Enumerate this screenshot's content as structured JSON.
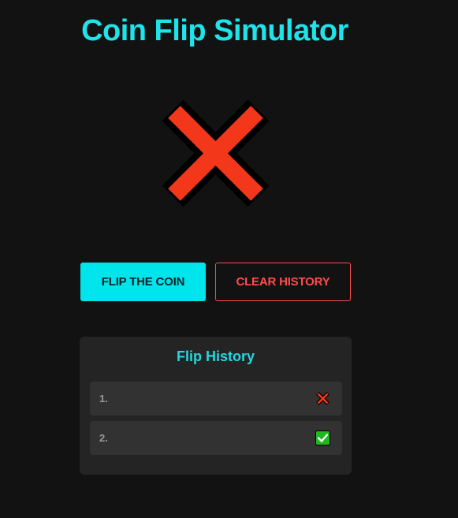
{
  "app": {
    "title": "Coin Flip Simulator"
  },
  "result": {
    "icon": "cross-mark-icon",
    "color": "#f2371b"
  },
  "buttons": {
    "flip_label": "FLIP THE COIN",
    "clear_label": "CLEAR HISTORY"
  },
  "history": {
    "title": "Flip History",
    "items": [
      {
        "index": "1.",
        "icon": "cross-mark-icon",
        "outcome": "cross"
      },
      {
        "index": "2.",
        "icon": "check-mark-icon",
        "outcome": "check"
      }
    ]
  },
  "colors": {
    "accent": "#00e5ec",
    "danger": "#ff4d4d",
    "background": "#121212",
    "panel": "#242424",
    "check_green": "#1fb81f"
  }
}
